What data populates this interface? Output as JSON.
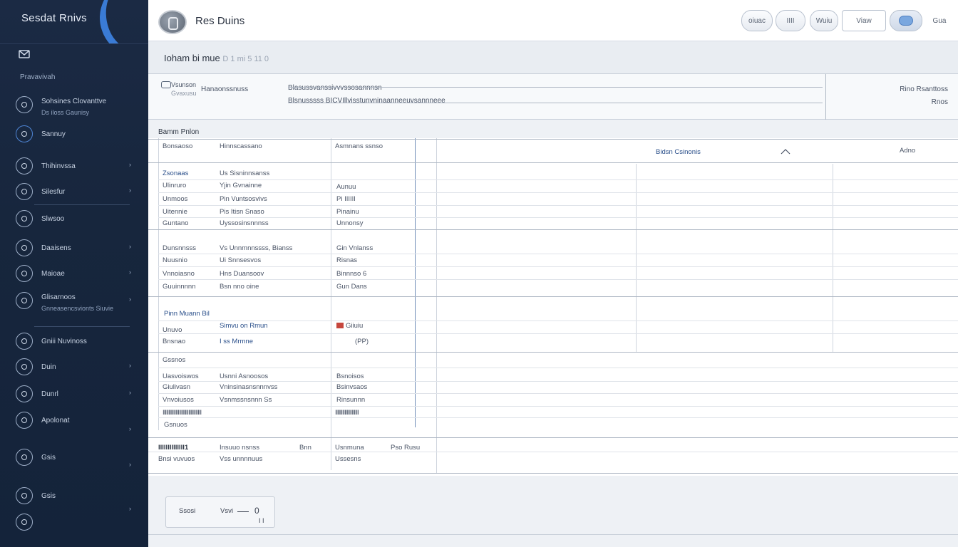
{
  "sidebar": {
    "brand": "Sesdat Rnivs",
    "section": "Pravavivah",
    "items": [
      {
        "label": "Sohsines Clovanttve",
        "sub": "Ds iloss      Gaunisy"
      },
      {
        "label": "Sannuy"
      },
      {
        "label": "Thihinvssa"
      },
      {
        "label": "Silesfur"
      },
      {
        "label": "Slwsoo"
      },
      {
        "label": "Daaisens"
      },
      {
        "label": "Maioae"
      },
      {
        "label": "Glisarnoos",
        "sub": "Gnneasencsvionts Siuvie"
      },
      {
        "label": "Gniii Nuvinoss"
      },
      {
        "label": "Duin"
      },
      {
        "label": "Dunrl"
      },
      {
        "label": "Apolonat"
      },
      {
        "label": "Gsis"
      },
      {
        "label": "Gsis"
      },
      {
        "label": ""
      }
    ]
  },
  "header": {
    "title": "Res Duins",
    "buttons": [
      "oiuac",
      "IIII",
      "Wuiu",
      "Viaw"
    ],
    "toggle_label": "Gua"
  },
  "subheader": {
    "title": "Ioham bi mue",
    "hint": "D 1 mi 5 11 0"
  },
  "info": {
    "col1_top": "Vsunson",
    "col1_bot": "Gvaxusu",
    "col2": "Hanaonssnuss",
    "col3_top": "Blasussvanssivvvssosannnsn",
    "col3_bot": "Blsnusssss  BICVIllvisstunvninaanneeuvsannneee",
    "right_top": "Rino Rsanttoss",
    "right_bot": "Rnos"
  },
  "table": {
    "title": "Bamm Pnlon",
    "header": {
      "c1": "Bonsaoso",
      "c2": "Hinnscassano",
      "c3": "Asmnans ssnso",
      "c5": "Bidsn Csinonis",
      "c6": "Adno"
    },
    "groups": [
      {
        "rows": [
          [
            "Zsonaas",
            "Us Sisninnsanss",
            ""
          ],
          [
            "Ulinruro",
            "Yjin Gvnainne",
            "Aunuu"
          ],
          [
            "Unmoos",
            "Pin Vuntsosvivs",
            "Pi IIIIII"
          ],
          [
            "Uitennie",
            "Pis Itisn Snaso",
            "Pinainu"
          ],
          [
            "Guntano",
            "Uyssosinsnnnss",
            "Unnonsy"
          ]
        ]
      },
      {
        "rows": [
          [
            "Dunsnnsss",
            "Vs Unnmnnssss, Bianss",
            "Gin Vnlanss"
          ],
          [
            "Nuusnio",
            "Ui Snnsesvos",
            "Risnas"
          ],
          [
            "Vnnoiasno",
            "Hns Duansoov",
            "Binnnso 6"
          ],
          [
            "Guuinnnnn",
            "Bsn nno oine",
            "Gun Dans"
          ]
        ]
      },
      {
        "label": "Pinn Muann Bil",
        "rows": [
          [
            "Unuvo",
            "Simvu on Rmun",
            "Giiuiu"
          ],
          [
            "Bnsnao",
            "I ss Mrmne",
            "(PP)"
          ]
        ]
      },
      {
        "label": "Gssnos",
        "rows": [
          [
            "Uasvoiswos",
            "Usnni Asnoosos",
            "Bsnoisos"
          ],
          [
            "Giulivasn",
            "Vninsinasnsnnnvss",
            "Bsinvsaos"
          ],
          [
            "Vnvoiusos",
            "Vsnmssnsnnn Ss",
            "Rinsunnn"
          ],
          [
            "IIIIIIIIIIIIIIIIIIIIIIIIIIIIIIIII",
            "",
            "IIIIIIIIIIIIIIIIIIII"
          ],
          [
            "Gsnuos",
            "",
            ""
          ]
        ]
      }
    ],
    "total_row": {
      "c1": "IIIIIIIIIIIIII1",
      "c2": "Insuuo nsnss",
      "c3": "Bnn",
      "c4": "Usnmuna",
      "c5": "Pso Rusu",
      "c1b": "Bnsi vuvuos",
      "c2b": "Vss unnnnuus",
      "c4b": "Ussesns"
    }
  },
  "footer": {
    "label_a": "Ssosi",
    "label_b": "Vsvi",
    "value": "0",
    "label_c": "I I"
  }
}
